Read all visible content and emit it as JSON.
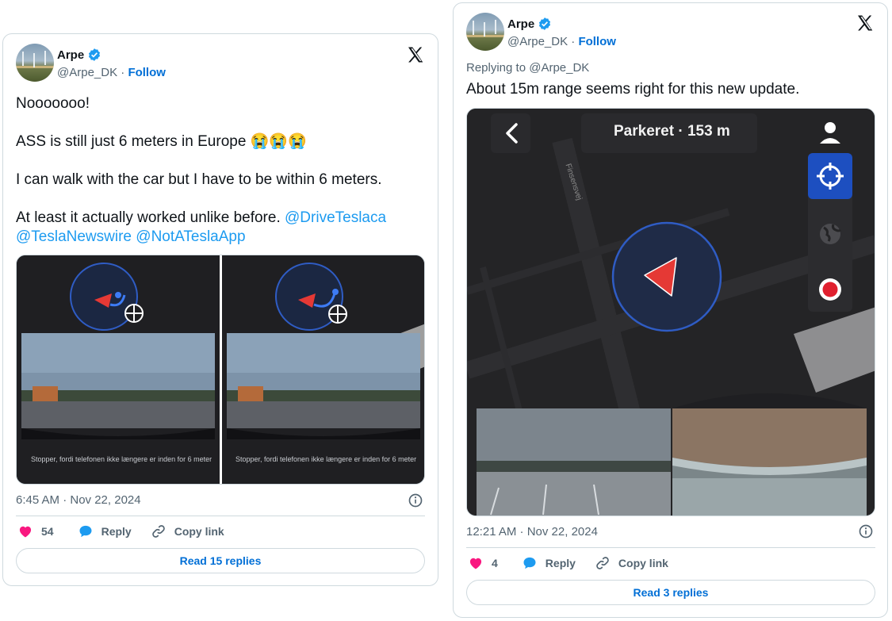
{
  "tweet1": {
    "author": {
      "name": "Arpe",
      "handle": "@Arpe_DK",
      "separator": "·",
      "follow": "Follow"
    },
    "lines": [
      {
        "text": "Nooooooo!"
      },
      {
        "text": "ASS is still just 6 meters in Europe 😭😭😭"
      },
      {
        "text": "I can walk with the car but I have to be within 6 meters."
      },
      {
        "text": "At least it actually worked unlike before. ",
        "mention": "@DriveTeslaca"
      },
      {
        "mentions": [
          "@TeslaNewswire",
          "@NotATeslaApp"
        ]
      }
    ],
    "media_caption_left": "Stopper, fordi telefonen ikke længere er inden for 6 meter",
    "media_caption_right": "Stopper, fordi telefonen ikke længere er inden for 6 meter",
    "timestamp": "6:45 AM · Nov 22, 2024",
    "likes": "54",
    "reply_label": "Reply",
    "copy_label": "Copy link",
    "read_replies": "Read 15 replies"
  },
  "tweet2": {
    "author": {
      "name": "Arpe",
      "handle": "@Arpe_DK",
      "separator": "·",
      "follow": "Follow"
    },
    "replying_to": "Replying to @Arpe_DK",
    "text": "About 15m range seems right for this new update.",
    "map_title": "Parkeret · 153 m",
    "street_name": "Finsensvej",
    "timestamp": "12:21 AM · Nov 22, 2024",
    "likes": "4",
    "reply_label": "Reply",
    "copy_label": "Copy link",
    "read_replies": "Read 3 replies"
  },
  "icons": {
    "verified": "verified-badge-icon",
    "x_logo": "x-logo-icon",
    "info": "info-icon",
    "heart": "heart-icon",
    "reply": "reply-bubble-icon",
    "link": "link-icon",
    "back": "chevron-left-icon",
    "user": "user-icon",
    "crosshair": "crosshair-icon",
    "globe": "globe-icon",
    "record": "record-icon"
  },
  "colors": {
    "link": "#006fd6",
    "mention": "#1d9bf0",
    "heart": "#f91880",
    "verified": "#1d9bf0",
    "map_accent": "#1d4fc0"
  }
}
